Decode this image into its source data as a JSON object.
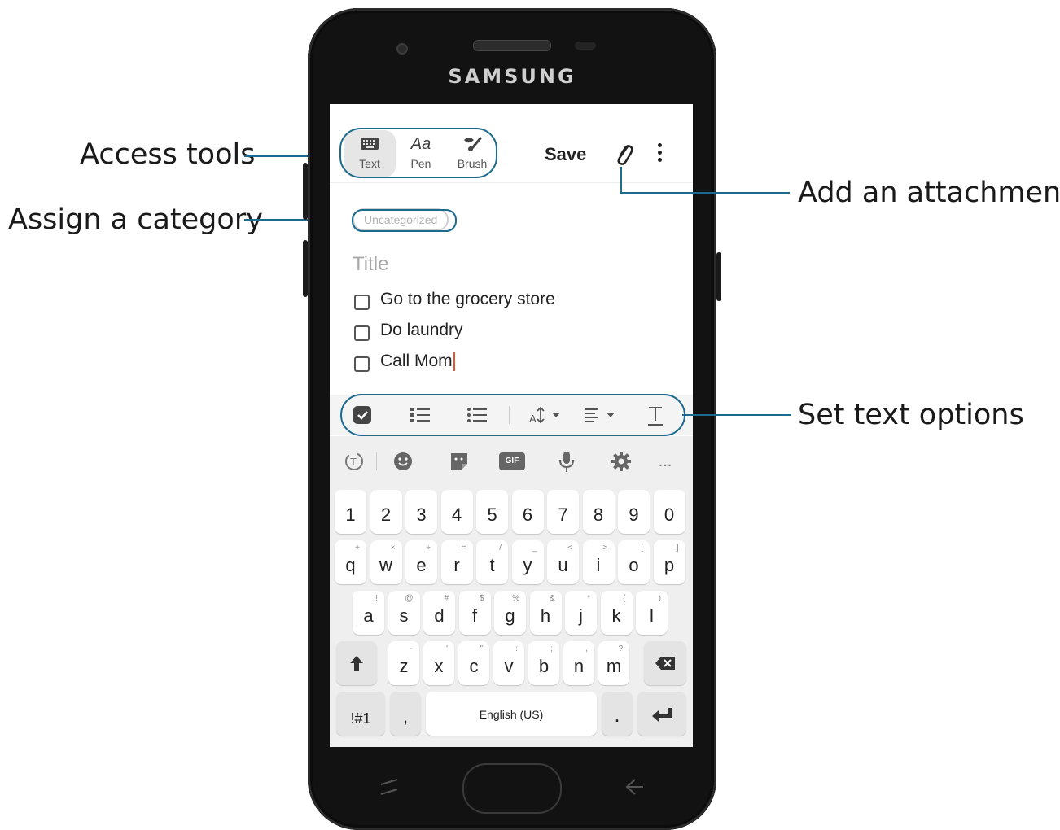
{
  "device": {
    "brand": "SAMSUNG"
  },
  "toolbar": {
    "tools": [
      {
        "label": "Text",
        "icon": "keyboard-icon"
      },
      {
        "label": "Pen",
        "icon": "pen-aa-icon"
      },
      {
        "label": "Brush",
        "icon": "brush-icon"
      }
    ],
    "save_label": "Save",
    "attach_icon": "paperclip-icon",
    "more_icon": "more-vertical-icon"
  },
  "note": {
    "category": "Uncategorized",
    "title_placeholder": "Title",
    "items": [
      {
        "text": "Go to the grocery store",
        "checked": false
      },
      {
        "text": "Do laundry",
        "checked": false
      },
      {
        "text": "Call Mom",
        "checked": false
      }
    ]
  },
  "format_bar": {
    "icons": [
      "checklist-icon",
      "numbered-list-icon",
      "bullet-list-icon",
      "text-size-icon",
      "align-icon",
      "text-style-icon"
    ]
  },
  "keyboard": {
    "suggestion_icons": [
      "translate-icon",
      "emoji-icon",
      "sticker-icon",
      "gif-icon",
      "mic-icon",
      "settings-icon",
      "more-icon"
    ],
    "gif_label": "GIF",
    "more_label": "...",
    "rows": {
      "numbers": [
        "1",
        "2",
        "3",
        "4",
        "5",
        "6",
        "7",
        "8",
        "9",
        "0"
      ],
      "row1": [
        [
          "q",
          "+"
        ],
        [
          "w",
          "×"
        ],
        [
          "e",
          "÷"
        ],
        [
          "r",
          "="
        ],
        [
          "t",
          "/"
        ],
        [
          "y",
          "_"
        ],
        [
          "u",
          "<"
        ],
        [
          "i",
          ">"
        ],
        [
          "o",
          "["
        ],
        [
          "p",
          "]"
        ]
      ],
      "row2": [
        [
          "a",
          "!"
        ],
        [
          "s",
          "@"
        ],
        [
          "d",
          "#"
        ],
        [
          "f",
          "$"
        ],
        [
          "g",
          "%"
        ],
        [
          "h",
          "&"
        ],
        [
          "j",
          "*"
        ],
        [
          "k",
          "("
        ],
        [
          "l",
          ")"
        ]
      ],
      "row3": [
        [
          "z",
          "-"
        ],
        [
          "x",
          "'"
        ],
        [
          "c",
          "\""
        ],
        [
          "v",
          ":"
        ],
        [
          "b",
          ";"
        ],
        [
          "n",
          ","
        ],
        [
          "m",
          "?"
        ]
      ]
    },
    "symbols_label": "!#1",
    "comma_label": ",",
    "space_label": "English (US)",
    "period_label": ".",
    "shift_icon": "shift-icon",
    "backspace_icon": "backspace-icon",
    "enter_icon": "enter-icon"
  },
  "callouts": {
    "access_tools": "Access tools",
    "assign_category": "Assign a category",
    "add_attachment": "Add an attachment",
    "set_text_options": "Set text options"
  },
  "colors": {
    "accent": "#1b6b8f",
    "caret": "#e4572e"
  }
}
